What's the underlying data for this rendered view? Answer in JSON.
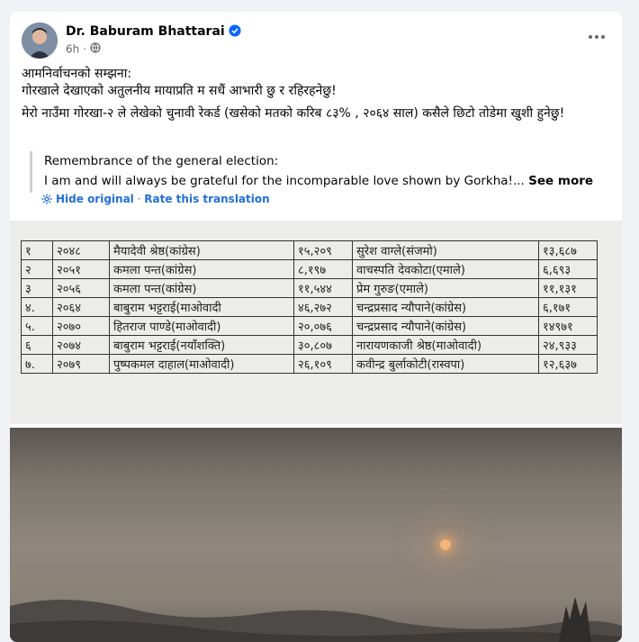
{
  "post": {
    "author": "Dr. Baburam Bhattarai",
    "time": "6h",
    "dot": "·",
    "body_line1": "आमनिर्वाचनको सम्झना:",
    "body_line2": "गोरखाले देखाएको अतुलनीय मायाप्रति म सधैं आभारी छु र रहिरहनेछु!",
    "body_line3": "मेरो नाउँमा गोरखा-२ ले लेखेको चुनावी रेकर्ड (खसेको मतको करिब ८३% , २०६४ साल)  कसैले छिटो तोडेमा खुशी हुनेछु!",
    "translation_line1": "Remembrance of the general election:",
    "translation_line2": "I am and will always be grateful for the incomparable love shown by Gorkha!...",
    "see_more": "See more",
    "hide_original": "Hide original",
    "link_separator": "·",
    "rate_translation": "Rate this translation"
  },
  "results_table": {
    "rows": [
      [
        "१",
        "२०४८",
        "मैयादेवी श्रेष्ठ(कांग्रेस)",
        "१५,२०९",
        "सुरेश वाग्ले(संजमो)",
        "१३,६८७"
      ],
      [
        "२",
        "२०५१",
        "कमला पन्त(कांग्रेस)",
        "८,१९७",
        "वाचस्पति देवकोटा(एमाले)",
        "६,६९३"
      ],
      [
        "३",
        "२०५६",
        "कमला पन्त(कांग्रेस)",
        "११,५४४",
        "प्रेम गुरुङ(एमाले)",
        "११,१३१"
      ],
      [
        "४.",
        "२०६४",
        "बाबुराम भट्टराई(माओवादी",
        "४६,२७२",
        "चन्द्रप्रसाद न्यौपाने(कांग्रेस)",
        "६,१७१"
      ],
      [
        "५.",
        "२०७०",
        "हितराज पाण्डे(माओवादी)",
        "२०,०७६",
        "चन्द्रप्रसाद न्यौपाने(कांग्रेस)",
        "१४९७१"
      ],
      [
        "६",
        "२०७४",
        "बाबुराम भट्टराई(नयाँशक्ति)",
        "३०,८०७",
        "नारायणकाजी श्रेष्ठ(माओवादी)",
        "२४,९३३"
      ],
      [
        "७.",
        "२०७९",
        "पुष्पकमल दाहाल(माओवादी)",
        "२६,१०९",
        "कवीन्द्र बुर्लाकोटी(रास्वपा)",
        "१२,६३७"
      ]
    ]
  },
  "icons": {
    "verified": "verified-badge-icon",
    "privacy": "globe-icon",
    "more": "more-options-icon",
    "translate": "translate-gear-icon"
  },
  "colors": {
    "link": "#216fdb",
    "meta": "#65676b",
    "verified": "#0866ff"
  }
}
